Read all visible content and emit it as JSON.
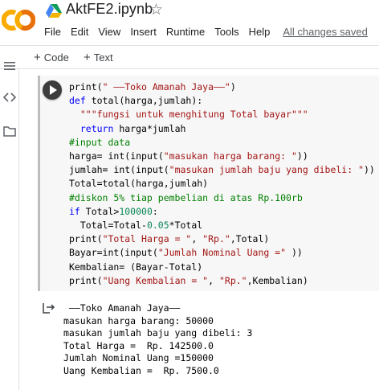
{
  "header": {
    "logo_text": "CO",
    "notebook_title": "AktFE2.ipynb",
    "star_glyph": "☆",
    "colors": {
      "logo_orange": "#f9ab00",
      "logo_yellow": "#e8710a"
    }
  },
  "menu": {
    "items": [
      "File",
      "Edit",
      "View",
      "Insert",
      "Runtime",
      "Tools",
      "Help"
    ],
    "save_status": "All changes saved"
  },
  "toolbar": {
    "add_code_label": "Code",
    "add_text_label": "Text",
    "plus_glyph": "+"
  },
  "sidebar": {
    "icons": [
      "menu-icon",
      "code-snippets-icon",
      "folder-icon"
    ]
  },
  "cell": {
    "code_lines": [
      "print(\" ——Toko Amanah Jaya——\")",
      "def total(harga,jumlah):",
      "  \"\"\"fungsi untuk menghitung Total bayar\"\"\"",
      "  return harga*jumlah",
      "#input data",
      "harga= int(input(\"masukan harga barang: \"))",
      "jumlah= int(input(\"masukan jumlah baju yang dibeli: \"))",
      "Total=total(harga,jumlah)",
      "#diskon 5% tiap pembelian di atas Rp.100rb",
      "if Total>100000:",
      "  Total=Total-0.05*Total",
      "print(\"Total Harga = \", \"Rp.\",Total)",
      "Bayar=int(input(\"Jumlah Nominal Uang =\" ))",
      "Kembalian= (Bayar-Total)",
      "print(\"Uang Kembalian = \", \"Rp.\",Kembalian)"
    ],
    "output_lines": [
      " ——Toko Amanah Jaya——",
      "masukan harga barang: 50000",
      "masukan jumlah baju yang dibeli: 3",
      "Total Harga =  Rp. 142500.0",
      "Jumlah Nominal Uang =150000",
      "Uang Kembalian =  Rp. 7500.0"
    ]
  }
}
